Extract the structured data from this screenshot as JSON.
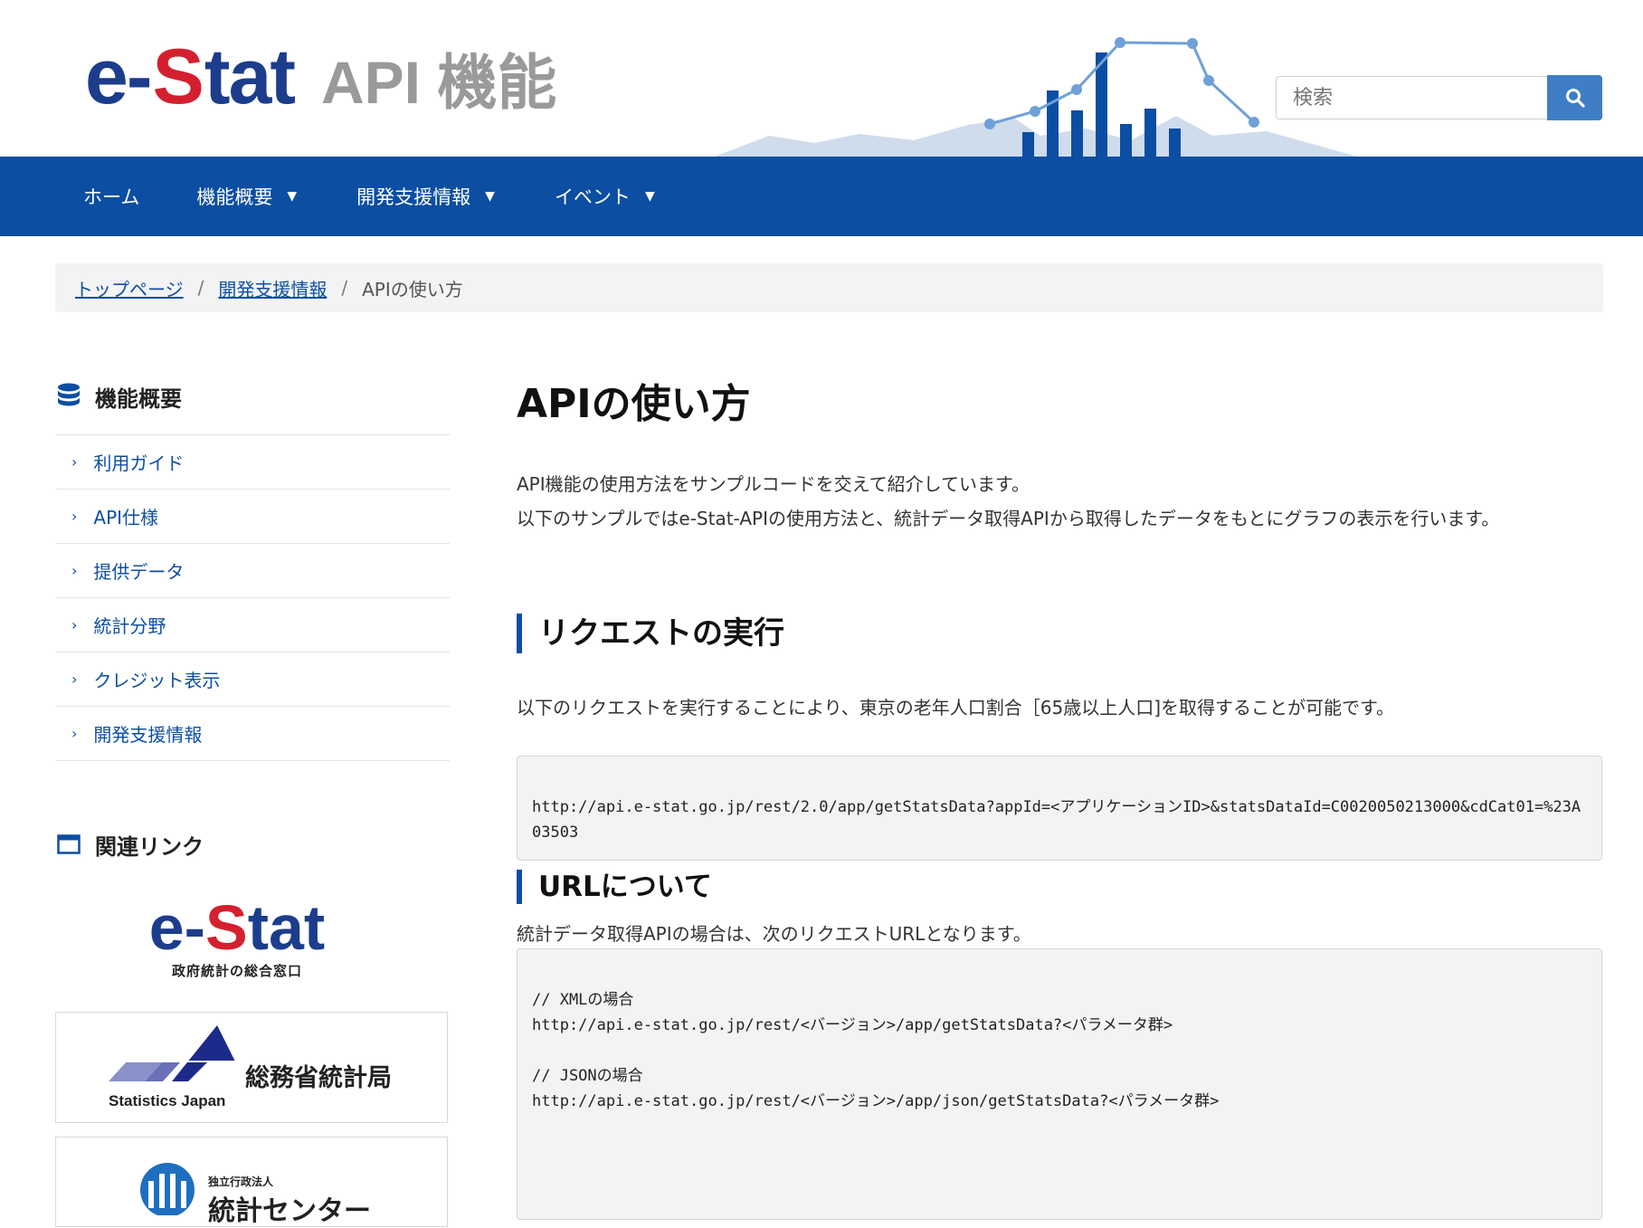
{
  "header": {
    "logo_e": "e",
    "logo_dash": "-",
    "logo_s": "S",
    "logo_tat": "tat",
    "logo_sub": "API 機能",
    "search_placeholder": "検索"
  },
  "nav": {
    "items": [
      {
        "label": "ホーム",
        "has_caret": false
      },
      {
        "label": "機能概要",
        "has_caret": true
      },
      {
        "label": "開発支援情報",
        "has_caret": true
      },
      {
        "label": "イベント",
        "has_caret": true
      }
    ],
    "caret": "▼"
  },
  "breadcrumb": {
    "items": [
      "トップページ",
      "開発支援情報"
    ],
    "separator": "/",
    "current": "APIの使い方"
  },
  "sidebar": {
    "heading": "機能概要",
    "items": [
      "利用ガイド",
      "API仕様",
      "提供データ",
      "統計分野",
      "クレジット表示",
      "開発支援情報"
    ],
    "chevron": "›",
    "related_heading": "関連リンク",
    "estat_logo_main": "e-Stat",
    "estat_logo_sub": "政府統計の総合窓口",
    "banner1_title": "総務省統計局",
    "banner1_sub": "Statistics Japan",
    "banner2_small": "独立行政法人",
    "banner2_title": "統計センター"
  },
  "main": {
    "title": "APIの使い方",
    "intro_line1": "API機能の使用方法をサンプルコードを交えて紹介しています。",
    "intro_line2": "以下のサンプルではe-Stat-APIの使用方法と、統計データ取得APIから取得したデータをもとにグラフの表示を行います。",
    "section1_heading": "リクエストの実行",
    "section1_text": "以下のリクエストを実行することにより、東京の老年人口割合［65歳以上人口]を取得することが可能です。",
    "code1": "http://api.e-stat.go.jp/rest/2.0/app/getStatsData?appId=<アプリケーションID>&statsDataId=C0020050213000&cdCat01=%23A03503",
    "section2_heading": "URLについて",
    "section2_text": "統計データ取得APIの場合は、次のリクエストURLとなります。",
    "code2_line1": "// XMLの場合",
    "code2_line2": "http://api.e-stat.go.jp/rest/<バージョン>/app/getStatsData?<パラメータ群>",
    "code2_line3": "// JSONの場合",
    "code2_line4": "http://api.e-stat.go.jp/rest/<バージョン>/app/json/getStatsData?<パラメータ群>"
  },
  "colors": {
    "nav_bg": "#0b4ea2",
    "link": "#0d4fa3",
    "logo_blue": "#1c3d8c",
    "logo_red": "#d4202e",
    "search_button": "#3f7ec4"
  }
}
